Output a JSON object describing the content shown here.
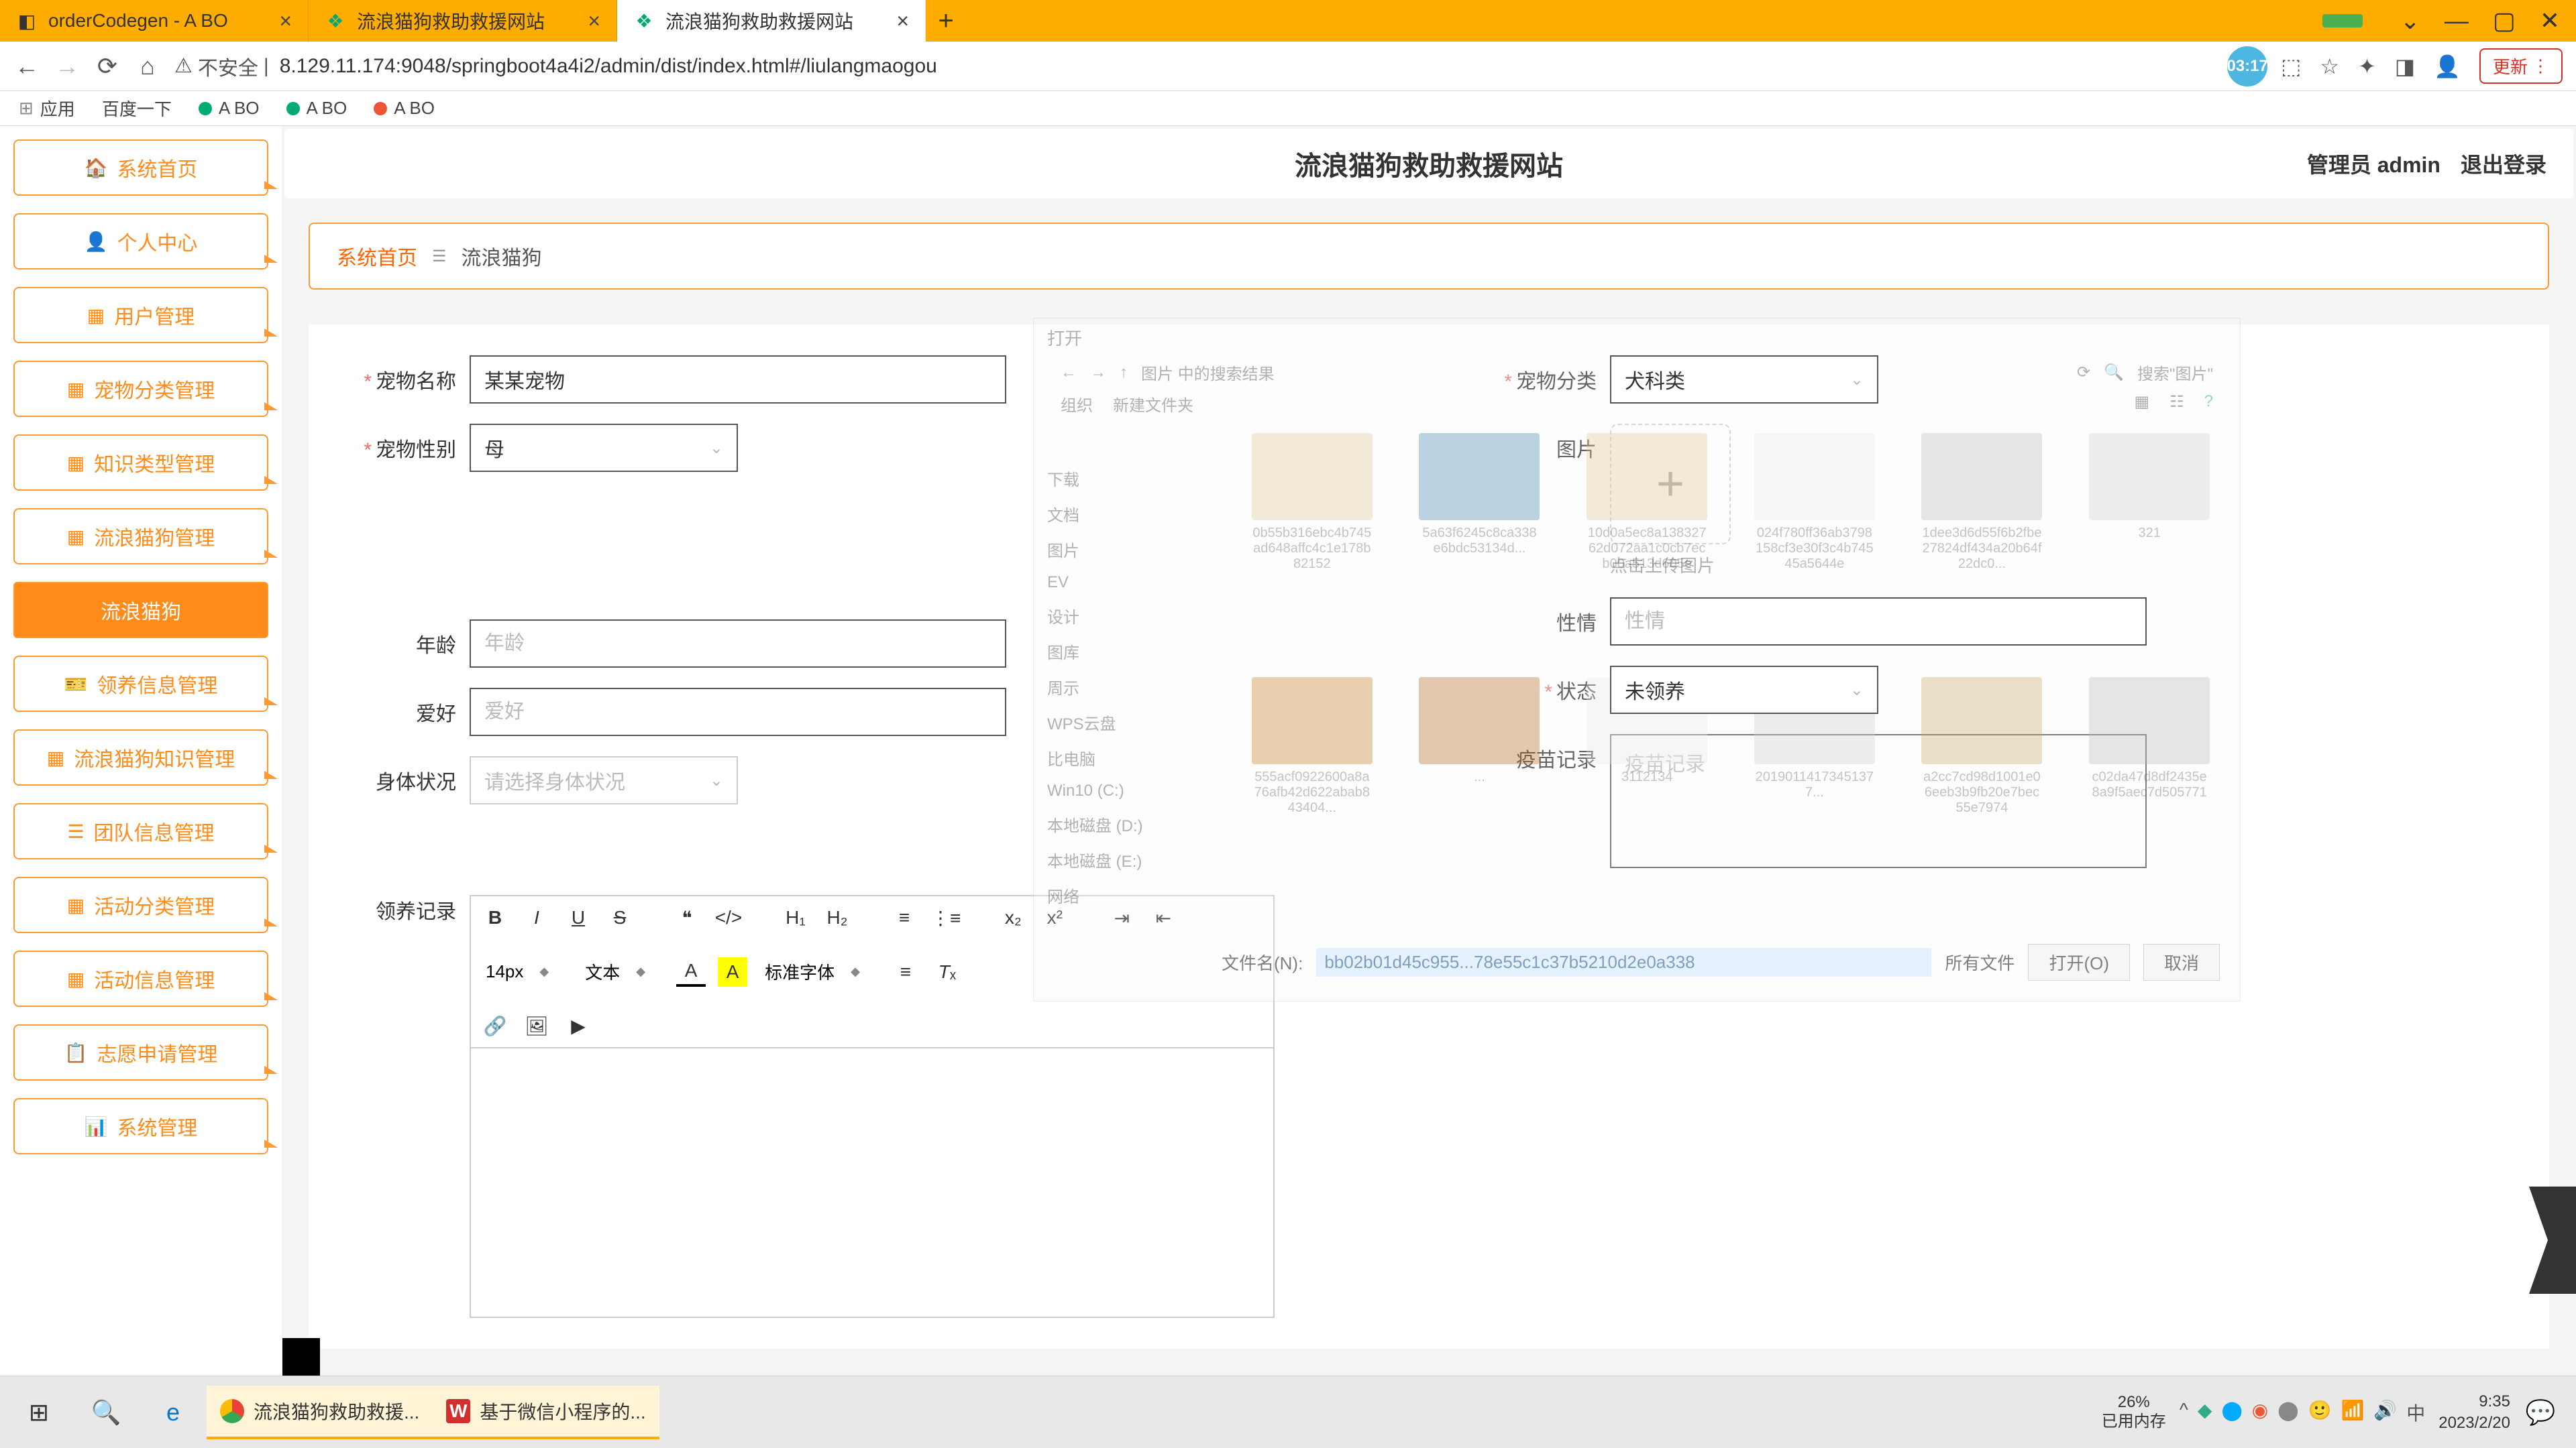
{
  "browser": {
    "tabs": [
      {
        "title": "orderCodegen - A BO",
        "active": false
      },
      {
        "title": "流浪猫狗救助救援网站",
        "active": false
      },
      {
        "title": "流浪猫狗救助救援网站",
        "active": true
      }
    ],
    "insecure_label": "不安全",
    "url": "8.129.11.174:9048/springboot4a4i2/admin/dist/index.html#/liulangmaogou",
    "time_badge": "03:17",
    "update_label": "更新",
    "bookmarks": {
      "apps": "应用",
      "baidu": "百度一下",
      "abo1": "A BO",
      "abo2": "A BO",
      "abo3": "A BO"
    }
  },
  "header": {
    "title": "流浪猫狗救助救援网站",
    "role": "管理员 admin",
    "logout": "退出登录"
  },
  "sidebar": {
    "items": [
      {
        "icon": "🏠",
        "label": "系统首页"
      },
      {
        "icon": "👤",
        "label": "个人中心"
      },
      {
        "icon": "▦",
        "label": "用户管理"
      },
      {
        "icon": "▦",
        "label": "宠物分类管理"
      },
      {
        "icon": "▦",
        "label": "知识类型管理"
      },
      {
        "icon": "▦",
        "label": "流浪猫狗管理"
      },
      {
        "icon": "",
        "label": "流浪猫狗"
      },
      {
        "icon": "🎫",
        "label": "领养信息管理"
      },
      {
        "icon": "▦",
        "label": "流浪猫狗知识管理"
      },
      {
        "icon": "☰",
        "label": "团队信息管理"
      },
      {
        "icon": "▦",
        "label": "活动分类管理"
      },
      {
        "icon": "▦",
        "label": "活动信息管理"
      },
      {
        "icon": "📋",
        "label": "志愿申请管理"
      },
      {
        "icon": "📊",
        "label": "系统管理"
      }
    ],
    "active_index": 6
  },
  "breadcrumb": {
    "home": "系统首页",
    "current": "流浪猫狗"
  },
  "form": {
    "pet_name": {
      "label": "宠物名称",
      "value": "某某宠物"
    },
    "pet_gender": {
      "label": "宠物性别",
      "value": "母"
    },
    "pet_category": {
      "label": "宠物分类",
      "value": "犬科类"
    },
    "image": {
      "label": "图片",
      "hint": "点击上传图片"
    },
    "age": {
      "label": "年龄",
      "placeholder": "年龄"
    },
    "temperament": {
      "label": "性情",
      "placeholder": "性情"
    },
    "hobby": {
      "label": "爱好",
      "placeholder": "爱好"
    },
    "status": {
      "label": "状态",
      "value": "未领养"
    },
    "body": {
      "label": "身体状况",
      "placeholder": "请选择身体状况"
    },
    "vaccine": {
      "label": "疫苗记录",
      "placeholder": "疫苗记录"
    },
    "adopt_record": {
      "label": "领养记录"
    }
  },
  "editor": {
    "font_size": "14px",
    "text_style": "文本",
    "font_family": "标准字体"
  },
  "dialog": {
    "title": "打开",
    "path": "图片 中的搜索结果",
    "search_placeholder": "搜索\"图片\"",
    "organize": "组织",
    "newfolder": "新建文件夹",
    "side_items": [
      "下载",
      "文档",
      "图片",
      "EV",
      "设计",
      "图库",
      "周示",
      "WPS云盘",
      "比电脑",
      "Win10 (C:)",
      "本地磁盘 (D:)",
      "本地磁盘 (E:)",
      "网络"
    ],
    "thumbs": [
      "0b55b316ebc4b745ad648affc4c1e178b82152",
      "5a63f6245c8ca338e6bdc53134d...",
      "10d0a5ec8a13832762d072aa1c0cb7ecb00a513d605e",
      "024f780ff36ab3798158cf3e30f3c4b74545a5644e",
      "1dee3d6d55f6b2fbe27824df434a20b64f22dc0...",
      "321",
      "555acf0922600a8a76afb42d622abab843404...",
      "...",
      "3112134",
      "20190114173451377...",
      "a2cc7cd98d1001e06eeb3b9fb20e7bec55e7974",
      "c02da47d8df2435e8a9f5aec7d505771"
    ],
    "filename_label": "文件名(N):",
    "filename_value": "bb02b01d45c955...78e55c1c37b5210d2e0a338",
    "filter": "所有文件",
    "open_btn": "打开(O)",
    "cancel_btn": "取消"
  },
  "taskbar": {
    "apps": [
      {
        "label": "流浪猫狗救助救援...",
        "color": "#4285f4"
      },
      {
        "label": "基于微信小程序的...",
        "color": "#d32f2f"
      }
    ],
    "memory_pct": "26%",
    "memory_label": "已用内存",
    "time": "9:35",
    "date": "2023/2/20"
  }
}
